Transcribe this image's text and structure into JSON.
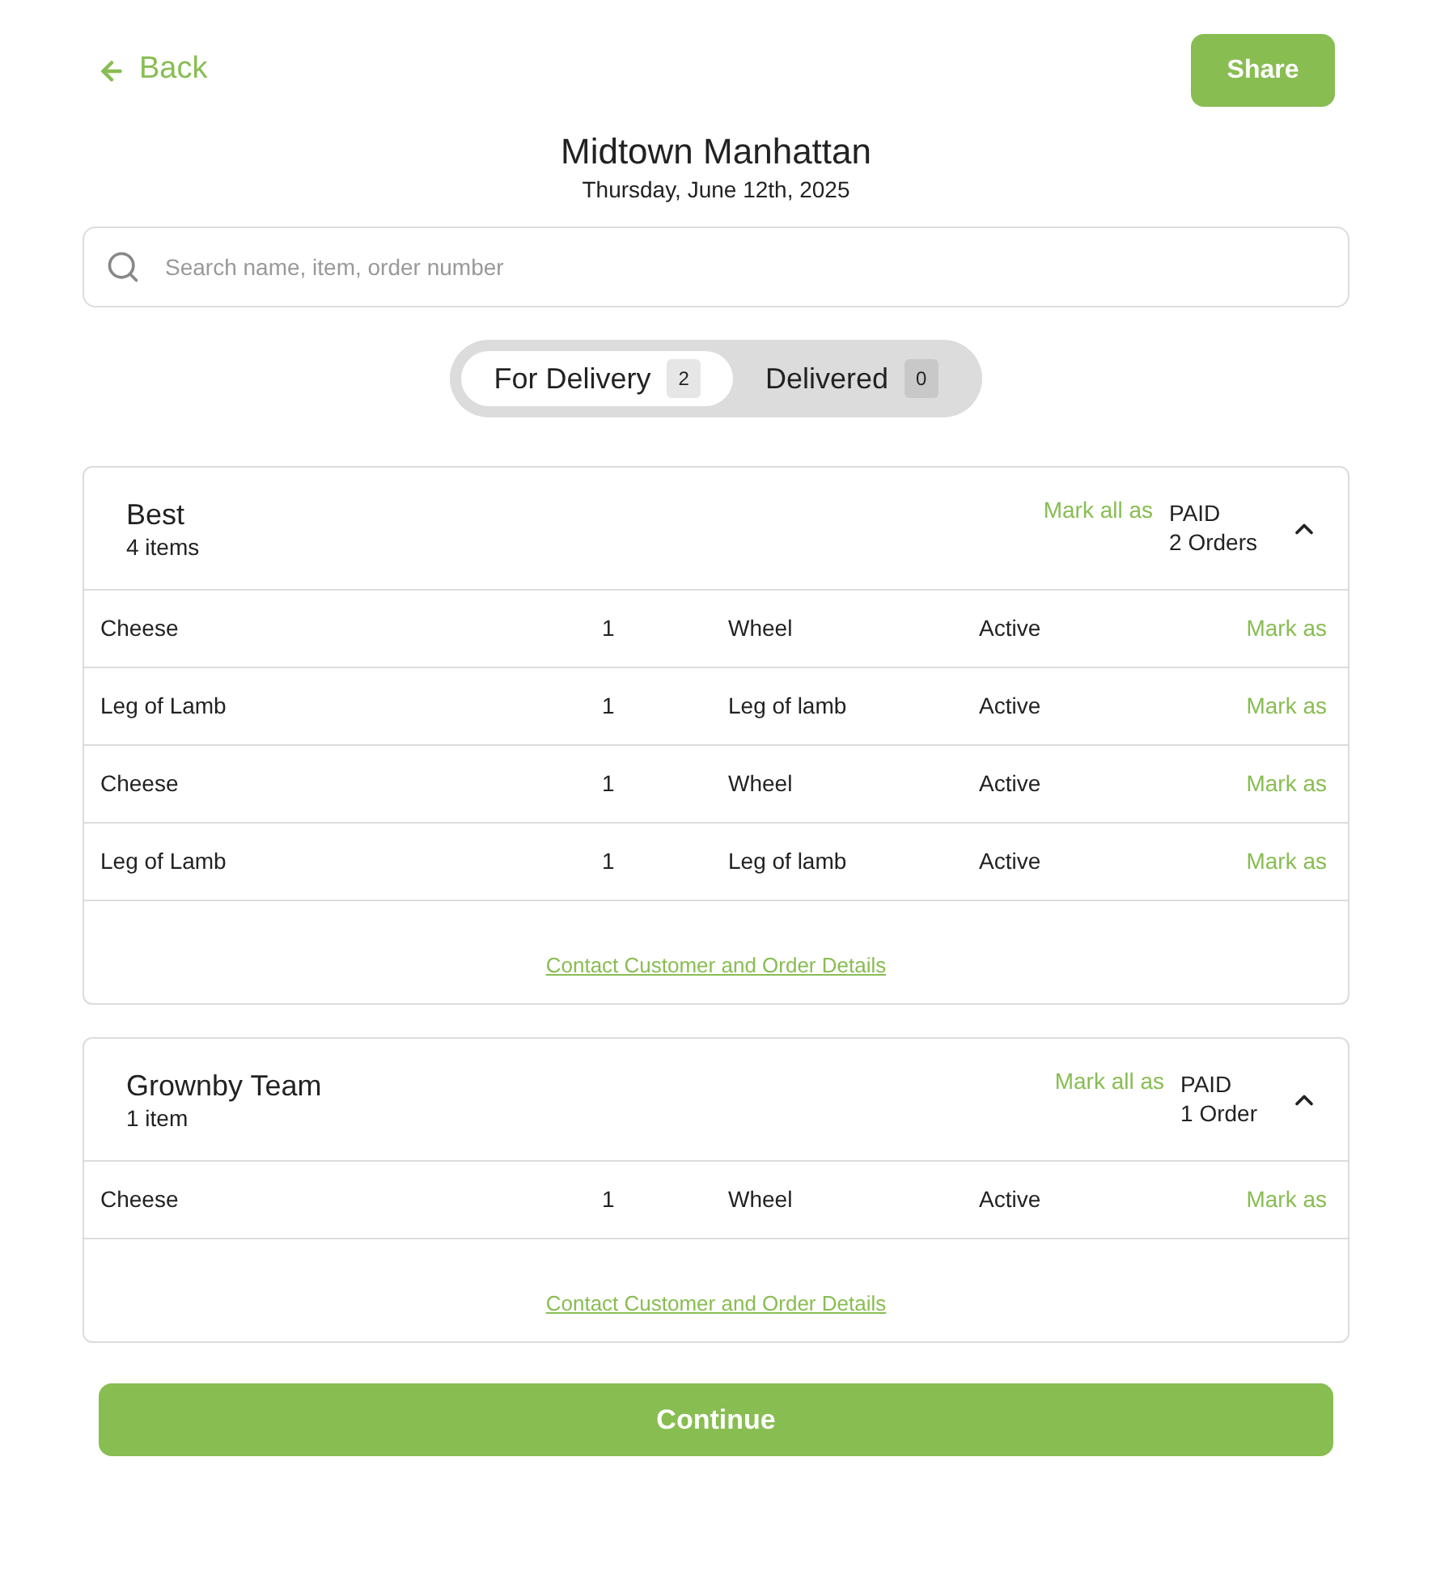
{
  "back": {
    "label": "Back"
  },
  "share": {
    "label": "Share"
  },
  "title": "Midtown Manhattan",
  "date": "Thursday, June 12th, 2025",
  "search": {
    "placeholder": "Search name, item, order number"
  },
  "tabs": [
    {
      "label": "For Delivery",
      "count": "2",
      "selected": true
    },
    {
      "label": "Delivered",
      "count": "0",
      "selected": false
    }
  ],
  "groups": [
    {
      "name": "Best",
      "items": "4 items",
      "mark_all": "Mark all as",
      "status": "PAID",
      "orders": "2 Orders",
      "expanded": true,
      "rows": [
        {
          "product": "Cheese",
          "qty": "1",
          "unit": "Wheel",
          "status": "Active",
          "action": "Mark as"
        },
        {
          "product": "Leg of Lamb",
          "qty": "1",
          "unit": "Leg of lamb",
          "status": "Active",
          "action": "Mark as"
        },
        {
          "product": "Cheese",
          "qty": "1",
          "unit": "Wheel",
          "status": "Active",
          "action": "Mark as"
        },
        {
          "product": "Leg of Lamb",
          "qty": "1",
          "unit": "Leg of lamb",
          "status": "Active",
          "action": "Mark as"
        }
      ],
      "link": "Contact Customer and Order Details"
    },
    {
      "name": "Grownby Team",
      "items": "1 item",
      "mark_all": "Mark all as",
      "status": "PAID",
      "orders": "1 Order",
      "expanded": true,
      "rows": [
        {
          "product": "Cheese",
          "qty": "1",
          "unit": "Wheel",
          "status": "Active",
          "action": "Mark as"
        }
      ],
      "link": "Contact Customer and Order Details"
    }
  ],
  "continue": {
    "label": "Continue"
  }
}
